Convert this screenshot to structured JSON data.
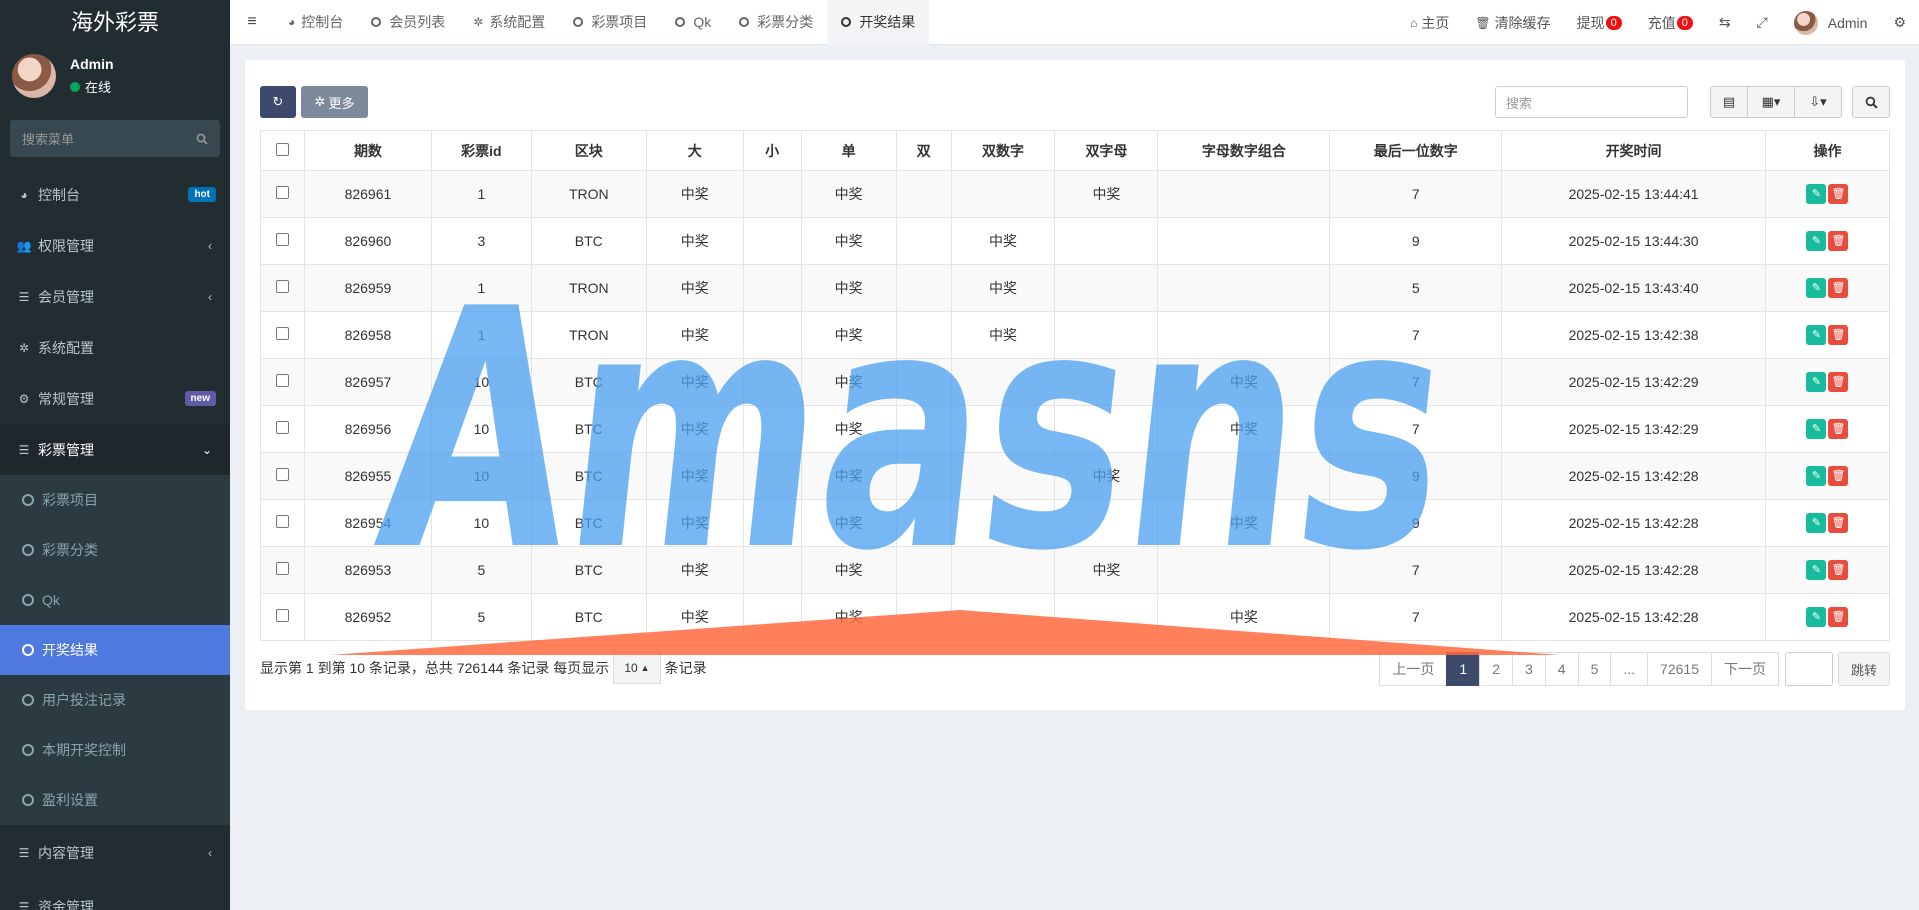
{
  "app": {
    "logo": "海外彩票"
  },
  "user": {
    "name": "Admin",
    "status": "在线"
  },
  "sidebar": {
    "search_placeholder": "搜索菜单",
    "items": [
      {
        "label": "控制台",
        "icon": "dashboard-icon",
        "badge": "hot"
      },
      {
        "label": "权限管理",
        "icon": "users-icon"
      },
      {
        "label": "会员管理",
        "icon": "list-icon"
      },
      {
        "label": "系统配置",
        "icon": "gear-icon"
      },
      {
        "label": "常规管理",
        "icon": "cogs-icon",
        "badge": "new"
      },
      {
        "label": "彩票管理",
        "icon": "list-icon"
      }
    ],
    "sub_items": [
      "彩票项目",
      "彩票分类",
      "Qk",
      "开奖结果",
      "用户投注记录",
      "本期开奖控制",
      "盈利设置"
    ],
    "after_items": [
      {
        "label": "内容管理",
        "icon": "list-icon"
      },
      {
        "label": "资金管理",
        "icon": "list-icon"
      }
    ]
  },
  "tabs": [
    "控制台",
    "会员列表",
    "系统配置",
    "彩票项目",
    "Qk",
    "彩票分类",
    "开奖结果"
  ],
  "topright": {
    "home": "主页",
    "clear_cache": "清除缓存",
    "withdraw": "提现",
    "withdraw_count": "0",
    "recharge": "充值",
    "recharge_count": "0",
    "admin": "Admin"
  },
  "toolbar": {
    "more": "更多",
    "search_placeholder": "搜索"
  },
  "table": {
    "headers": [
      "期数",
      "彩票id",
      "区块",
      "大",
      "小",
      "单",
      "双",
      "双数字",
      "双字母",
      "字母数字组合",
      "最后一位数字",
      "开奖时间",
      "操作"
    ],
    "rows": [
      [
        "826961",
        "1",
        "TRON",
        "中奖",
        "",
        "中奖",
        "",
        "",
        "中奖",
        "",
        "7",
        "2025-02-15 13:44:41"
      ],
      [
        "826960",
        "3",
        "BTC",
        "中奖",
        "",
        "中奖",
        "",
        "中奖",
        "",
        "",
        "9",
        "2025-02-15 13:44:30"
      ],
      [
        "826959",
        "1",
        "TRON",
        "中奖",
        "",
        "中奖",
        "",
        "中奖",
        "",
        "",
        "5",
        "2025-02-15 13:43:40"
      ],
      [
        "826958",
        "1",
        "TRON",
        "中奖",
        "",
        "中奖",
        "",
        "中奖",
        "",
        "",
        "7",
        "2025-02-15 13:42:38"
      ],
      [
        "826957",
        "10",
        "BTC",
        "中奖",
        "",
        "中奖",
        "",
        "",
        "",
        "中奖",
        "7",
        "2025-02-15 13:42:29"
      ],
      [
        "826956",
        "10",
        "BTC",
        "中奖",
        "",
        "中奖",
        "",
        "",
        "",
        "中奖",
        "7",
        "2025-02-15 13:42:29"
      ],
      [
        "826955",
        "10",
        "BTC",
        "中奖",
        "",
        "中奖",
        "",
        "",
        "中奖",
        "",
        "9",
        "2025-02-15 13:42:28"
      ],
      [
        "826954",
        "10",
        "BTC",
        "中奖",
        "",
        "中奖",
        "",
        "",
        "",
        "中奖",
        "9",
        "2025-02-15 13:42:28"
      ],
      [
        "826953",
        "5",
        "BTC",
        "中奖",
        "",
        "中奖",
        "",
        "",
        "中奖",
        "",
        "7",
        "2025-02-15 13:42:28"
      ],
      [
        "826952",
        "5",
        "BTC",
        "中奖",
        "",
        "中奖",
        "",
        "",
        "",
        "中奖",
        "7",
        "2025-02-15 13:42:28"
      ]
    ]
  },
  "footer": {
    "info_prefix": "显示第 1 到第 10 条记录，总共 726144 条记录 每页显示",
    "page_size": "10",
    "info_suffix": "条记录"
  },
  "pager": {
    "prev": "上一页",
    "pages": [
      "1",
      "2",
      "3",
      "4",
      "5",
      "...",
      "72615"
    ],
    "active": "1",
    "next": "下一页",
    "jump": "跳转"
  },
  "watermark": {
    "text": "Amasns",
    "color": "#4a9ff0",
    "accent": "#ff6a3d"
  }
}
